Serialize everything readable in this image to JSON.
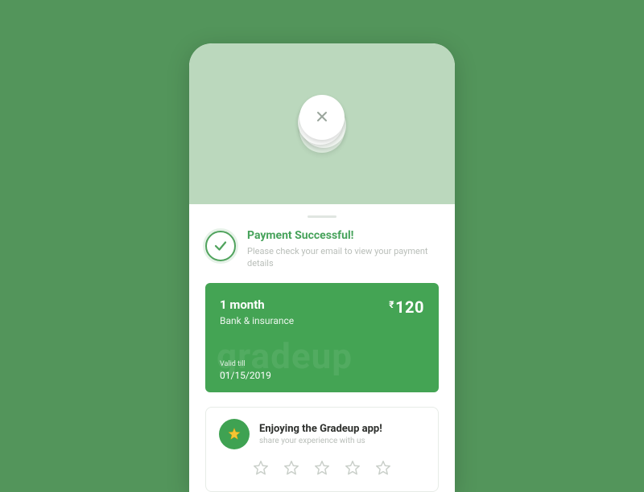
{
  "status": {
    "title": "Payment Successful!",
    "subtitle": "Please check your email to view your payment details"
  },
  "plan": {
    "duration": "1 month",
    "category": "Bank & insurance",
    "currency": "₹",
    "amount": "120",
    "watermark": "gradeup",
    "valid_label": "Valid till",
    "valid_date": "01/15/2019"
  },
  "rating": {
    "title": "Enjoying the Gradeup app!",
    "subtitle": "share your experience with us"
  }
}
